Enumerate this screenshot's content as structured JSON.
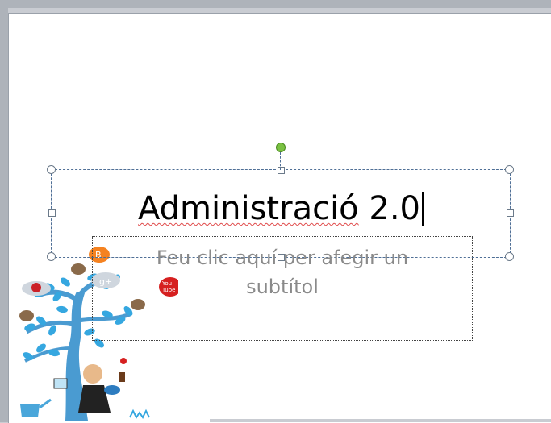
{
  "slide": {
    "title": {
      "prefix": "Administració",
      "suffix": " 2.0"
    },
    "subtitle_placeholder": {
      "line1": "Feu clic aquí per afegir un",
      "line2": "subtítol"
    }
  },
  "illustration": {
    "icons": [
      "pinterest-icon",
      "google-plus-icon",
      "blogger-icon",
      "youtube-icon",
      "twitter-bird-icon",
      "watering-can-icon"
    ],
    "labels": {
      "google_plus": "g+",
      "youtube": "You Tube",
      "blogger": "B"
    }
  },
  "colors": {
    "selection_border": "#4f6f96",
    "rotate_handle": "#7ac142",
    "placeholder_text": "#8a8a8a",
    "tree_leaves": "#35a7e0"
  }
}
